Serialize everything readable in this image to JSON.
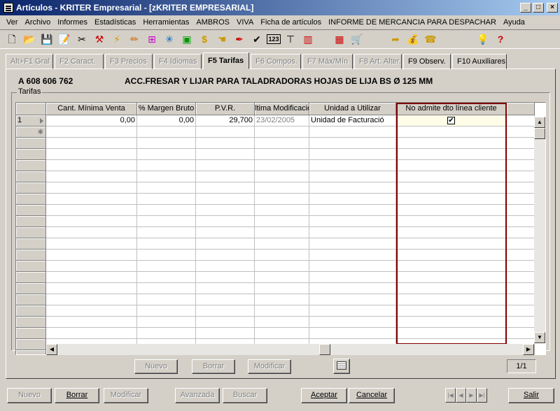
{
  "window": {
    "title": "Artículos - KRITER Empresarial - [zKRITER EMPRESARIAL]",
    "controls": {
      "minimize": "_",
      "maximize": "□",
      "close": "×"
    }
  },
  "menu": [
    "Ver",
    "Archivo",
    "Informes",
    "Estadísticas",
    "Herramientas",
    "AMBROS",
    "VIVA",
    "Ficha de artículos",
    "INFORME DE MERCANCIA PARA DESPACHAR",
    "Ayuda"
  ],
  "toolbar": {
    "icons": [
      {
        "name": "new-document-icon",
        "glyph": "🗋"
      },
      {
        "name": "open-folder-icon",
        "glyph": "📂"
      },
      {
        "name": "save-icon",
        "glyph": "💾"
      },
      {
        "name": "edit-icon",
        "glyph": "📝"
      },
      {
        "name": "cut-icon",
        "glyph": "✂"
      },
      {
        "name": "tools-icon",
        "glyph": "⚒"
      },
      {
        "name": "yellow-tool-icon",
        "glyph": "⚡"
      },
      {
        "name": "pencil-icon",
        "glyph": "✏"
      },
      {
        "name": "tree-icon",
        "glyph": "⊞"
      },
      {
        "name": "asterisk-icon",
        "glyph": "✳"
      },
      {
        "name": "green-box-icon",
        "glyph": "▣"
      },
      {
        "name": "dollar-icon",
        "glyph": "$"
      },
      {
        "name": "hand-icon",
        "glyph": "☚"
      },
      {
        "name": "feather-icon",
        "glyph": "✒"
      },
      {
        "name": "check-icon",
        "glyph": "✔"
      },
      {
        "name": "numbers-icon",
        "glyph": "123"
      },
      {
        "name": "stamp-icon",
        "glyph": "⊤"
      },
      {
        "name": "bar-chart-icon",
        "glyph": "▥"
      },
      {
        "name": "calculator-icon",
        "glyph": "▦"
      },
      {
        "name": "cart-icon",
        "glyph": "🛒"
      },
      {
        "name": "tag-icon",
        "glyph": "➦"
      },
      {
        "name": "money-bag-icon",
        "glyph": "💰"
      },
      {
        "name": "phone-icon",
        "glyph": "☎"
      },
      {
        "name": "lightbulb-icon",
        "glyph": "💡"
      },
      {
        "name": "help-icon",
        "glyph": "?"
      }
    ]
  },
  "tabs": [
    {
      "label": "Alt+F1 Gral",
      "state": "disabled"
    },
    {
      "label": "F2 Caract.",
      "state": "disabled"
    },
    {
      "label": "F3 Precios",
      "state": "disabled"
    },
    {
      "label": "F4 Idiomas",
      "state": "disabled"
    },
    {
      "label": "F5 Tarifas",
      "state": "active"
    },
    {
      "label": "F6 Compos.",
      "state": "disabled"
    },
    {
      "label": "F7 Máx/Mín",
      "state": "disabled"
    },
    {
      "label": "F8 Art. Alter.",
      "state": "disabled"
    },
    {
      "label": "F9 Observ.",
      "state": "enabled"
    },
    {
      "label": "F10 Auxiliares",
      "state": "enabled"
    }
  ],
  "article": {
    "code": "A 608 606 762",
    "description": "ACC.FRESAR Y LIJAR PARA TALADRADORAS HOJAS DE LIJA BS Ø 125 MM"
  },
  "group_label": "Tarifas",
  "grid": {
    "columns": [
      "Cant. Mínima Venta",
      "% Margen Bruto",
      "P.V.R.",
      "ltima Modificació",
      "Unidad a Utilizar",
      "No admite dto línea cliente"
    ],
    "rows": [
      {
        "index": "1",
        "cant_minima": "0,00",
        "margen": "0,00",
        "pvr": "29,700",
        "ultima_mod": "23/02/2005",
        "unidad": "Unidad de Facturació",
        "no_admite": "✔"
      }
    ]
  },
  "panel_buttons": {
    "nuevo": "Nuevo",
    "borrar": "Borrar",
    "modificar": "Modificar"
  },
  "record_counter": "1/1",
  "bottom_buttons": {
    "nuevo": "Nuevo",
    "borrar": "Borrar",
    "modificar": "Modificar",
    "avanzada": "Avanzada",
    "buscar": "Buscar",
    "aceptar": "Aceptar",
    "cancelar": "Cancelar",
    "salir": "Salir"
  }
}
